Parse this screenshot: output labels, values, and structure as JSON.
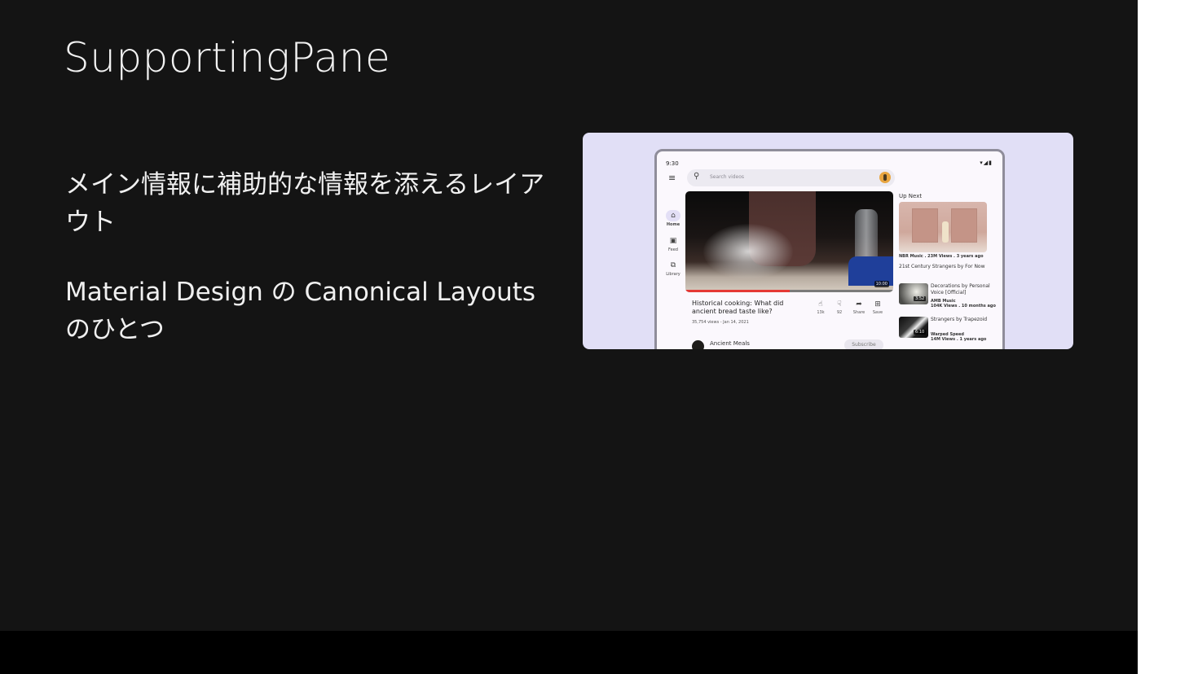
{
  "slide": {
    "title": "SupportingPane",
    "bullets": [
      "メイン情報に補助的な情報を添えるレイアウト",
      "Material Design の Canonical Layouts のひとつ"
    ]
  },
  "mockup": {
    "status": {
      "time": "9:30",
      "icons": "▾◢▮"
    },
    "search": {
      "placeholder": "Search videos"
    },
    "nav_rail": [
      {
        "label": "Home",
        "icon": "home-icon",
        "active": true
      },
      {
        "label": "Feed",
        "icon": "feed-icon"
      },
      {
        "label": "Library",
        "icon": "library-icon"
      }
    ],
    "video": {
      "duration": "10:00",
      "title": "Historical cooking: What did ancient bread taste like?",
      "meta": "35,754 views - Jan 14, 2021",
      "progress": 0.5,
      "actions": [
        {
          "label": "13k",
          "icon": "thumbs-up-icon"
        },
        {
          "label": "92",
          "icon": "thumbs-down-icon"
        },
        {
          "label": "Share",
          "icon": "share-icon"
        },
        {
          "label": "Save",
          "icon": "save-icon"
        }
      ],
      "channel": "Ancient Meals",
      "subscribe": "Subscribe"
    },
    "up_next": {
      "heading": "Up Next",
      "items": [
        {
          "meta": "NBR Music . 23M Views . 3 years ago",
          "title": "21st Century Strangers by For Now"
        },
        {
          "title": "Decorations by Personal Voice [Official]",
          "channel": "AMB Music",
          "views": "104K Views . 10 months ago",
          "duration": "3:52"
        },
        {
          "title": "Strangers by Trapezoid",
          "channel": "Warped Speed",
          "views": "14M Views . 1 years ago",
          "duration": "6:10"
        }
      ]
    }
  }
}
